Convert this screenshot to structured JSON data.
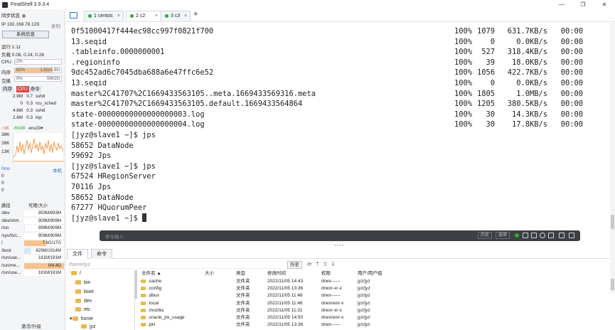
{
  "window": {
    "title": "FinalShell 3.9.3.4",
    "controls": [
      "—",
      "❐",
      "✕"
    ]
  },
  "sidebar": {
    "sync_label": "同步状态",
    "ip_label": "IP 192.168.78.129",
    "copy_label": "复制",
    "sysinfo_button": "系统信息",
    "uptime": "运行 1:11",
    "load": "负载 0.08, 0.24, 0.28",
    "cpu": {
      "label": "CPU",
      "value": "2%",
      "percent": 2
    },
    "mem": {
      "label": "内存",
      "value": "82%",
      "detail": "1.5G/1.8G",
      "percent": 82
    },
    "swap": {
      "label": "交换",
      "value": "0%",
      "detail": "5M/2G",
      "percent": 0
    },
    "proc_tabs": [
      "内存",
      "CPU",
      "命令"
    ],
    "processes": [
      {
        "mem": "2.9M",
        "cpu": "0.7",
        "cmd": "sshd"
      },
      {
        "mem": "0",
        "cpu": "0.3",
        "cmd": "rcu_sched"
      },
      {
        "mem": "4.6M",
        "cpu": "0.3",
        "cmd": "sshd"
      },
      {
        "mem": "2.8M",
        "cpu": "0.3",
        "cmd": "top"
      }
    ],
    "net": {
      "up": "↑1K",
      "down": "↓654B",
      "iface": "ens33"
    },
    "net_scale": [
      "38K",
      "26K",
      "13K"
    ],
    "ping": {
      "label": "0ms",
      "host": "本机",
      "values": [
        "0",
        "0",
        "0"
      ]
    },
    "disk_header": {
      "path": "路径",
      "size": "可用/大小"
    },
    "disks": [
      {
        "path": "/dev",
        "value": "893M/893M",
        "used": 0
      },
      {
        "path": "/dev/shm",
        "value": "909M/909M",
        "used": 0
      },
      {
        "path": "/run",
        "value": "899M/909M",
        "used": 1
      },
      {
        "path": "/sys/fs/c...",
        "value": "909M/909M",
        "used": 0
      },
      {
        "path": "/",
        "value": "7.6G/17G",
        "used": 55
      },
      {
        "path": "/boot",
        "value": "829M/1014M",
        "used": 18
      },
      {
        "path": "/run/use...",
        "value": "181M/181M",
        "used": 0
      },
      {
        "path": "/run/me...",
        "value": "0/4.4G",
        "used": 100
      },
      {
        "path": "/run/use...",
        "value": "181M/181M",
        "used": 0
      }
    ],
    "upgrade": "激活/升级"
  },
  "tabs": [
    {
      "label": "1 centos"
    },
    {
      "label": "2 c2"
    },
    {
      "label": "3 c3"
    }
  ],
  "terminal": {
    "transfers": [
      {
        "name": "0f51000417f444ec98cc997f0821f700",
        "pct": "100%",
        "size": "1079",
        "rate": "631.7KB/s",
        "time": "00:00"
      },
      {
        "name": "13.seqid",
        "pct": "100%",
        "size": "0",
        "rate": "0.0KB/s",
        "time": "00:00"
      },
      {
        "name": ".tableinfo.0000000001",
        "pct": "100%",
        "size": "527",
        "rate": "318.4KB/s",
        "time": "00:00"
      },
      {
        "name": ".regioninfo",
        "pct": "100%",
        "size": "39",
        "rate": "18.0KB/s",
        "time": "00:00"
      },
      {
        "name": "9dc452ad6c7045dba688a6e47ffc6e52",
        "pct": "100%",
        "size": "1056",
        "rate": "422.7KB/s",
        "time": "00:00"
      },
      {
        "name": "13.seqid",
        "pct": "100%",
        "size": "0",
        "rate": "0.0KB/s",
        "time": "00:00"
      },
      {
        "name": "master%2C41707%2C1669433563105..meta.1669433569316.meta",
        "pct": "100%",
        "size": "1805",
        "rate": "1.0MB/s",
        "time": "00:00"
      },
      {
        "name": "master%2C41707%2C1669433563105.default.1669433564864",
        "pct": "100%",
        "size": "1205",
        "rate": "380.5KB/s",
        "time": "00:00"
      },
      {
        "name": "state-00000000000000000003.log",
        "pct": "100%",
        "size": "30",
        "rate": "14.3KB/s",
        "time": "00:00"
      },
      {
        "name": "state-00000000000000000004.log",
        "pct": "100%",
        "size": "30",
        "rate": "17.8KB/s",
        "time": "00:00"
      }
    ],
    "lines": [
      "[jyz@slave1 ~]$ jps",
      "58652 DataNode",
      "59692 Jps",
      "[jyz@slave1 ~]$ jps",
      "67524 HRegionServer",
      "70116 Jps",
      "58652 DataNode",
      "67277 HQuorumPeer",
      "[jyz@slave1 ~]$ "
    ]
  },
  "cmdbar": {
    "placeholder": "命令输入",
    "history_btn": "历史",
    "options_btn": "选项"
  },
  "bottom": {
    "tabs": [
      "文件",
      "命令"
    ],
    "path": "/home/jyz",
    "history_btn": "历史",
    "tree": [
      "/",
      "bin",
      "boot",
      "dev",
      "etc",
      "home",
      "jyz"
    ],
    "columns": [
      "文件名 ▲",
      "大小",
      "类型",
      "修改时间",
      "权限",
      "用户/用户组"
    ],
    "files": [
      {
        "name": ".cache",
        "size": "",
        "type": "文件夹",
        "mtime": "2022/11/05 14:43",
        "perm": "drwx------",
        "owner": "jyz/jyz"
      },
      {
        "name": ".config",
        "size": "",
        "type": "文件夹",
        "mtime": "2022/11/05 13:36",
        "perm": "drwxr-xr-x",
        "owner": "jyz/jyz"
      },
      {
        "name": ".dbus",
        "size": "",
        "type": "文件夹",
        "mtime": "2022/11/05 11:46",
        "perm": "drwx------",
        "owner": "jyz/jyz"
      },
      {
        "name": ".local",
        "size": "",
        "type": "文件夹",
        "mtime": "2022/11/05 11:46",
        "perm": "drwxrwxr-x",
        "owner": "jyz/jyz"
      },
      {
        "name": ".mozilla",
        "size": "",
        "type": "文件夹",
        "mtime": "2022/11/05 11:31",
        "perm": "drwxr-xr-x",
        "owner": "jyz/jyz"
      },
      {
        "name": ".oracle_jre_usage",
        "size": "",
        "type": "文件夹",
        "mtime": "2022/11/05 14:50",
        "perm": "drwxrwxr-x",
        "owner": "jyz/jyz"
      },
      {
        "name": ".pki",
        "size": "",
        "type": "文件夹",
        "mtime": "2022/11/05 13:36",
        "perm": "drwx------",
        "owner": "jyz/jyz"
      }
    ]
  },
  "colors": {
    "accent_blue": "#2a6fd6",
    "tab_green": "#27ae3a",
    "mem_fill": "#f5c28f",
    "cpu_fill": "#c9e2fb",
    "proc_active": "#e04848",
    "graph": "#f29b4e",
    "folder": "#e9b949"
  },
  "icons": [
    "folder-icon",
    "refresh-icon",
    "upload-icon",
    "download-icon",
    "search-icon",
    "settings-icon"
  ]
}
